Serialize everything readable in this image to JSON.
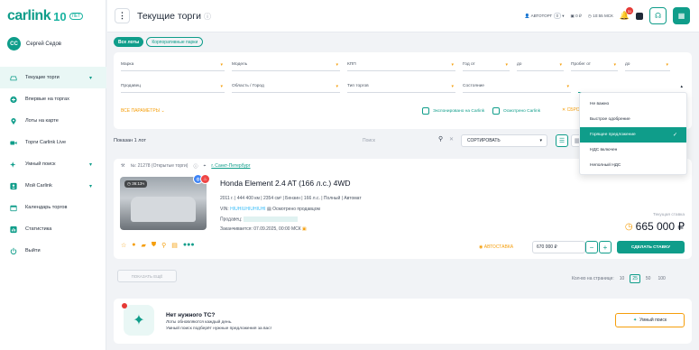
{
  "brand": {
    "name": "carlink",
    "anniversary": "10",
    "anniversary_suffix": "ЛЕТ"
  },
  "user": {
    "initials": "СС",
    "name": "Сергей Седов"
  },
  "sidebar": {
    "items": [
      {
        "label": "Текущие торги",
        "icon": "car-icon"
      },
      {
        "label": "Впервые на торгах",
        "icon": "plus-circle-icon"
      },
      {
        "label": "Лоты на карте",
        "icon": "map-pin-icon"
      },
      {
        "label": "Торги Carlink Live",
        "icon": "video-icon"
      },
      {
        "label": "Умный поиск",
        "icon": "sparkle-icon"
      },
      {
        "label": "Мой Carlink",
        "icon": "person-card-icon"
      },
      {
        "label": "Календарь торгов",
        "icon": "calendar-icon"
      },
      {
        "label": "Статистика",
        "icon": "chart-icon"
      },
      {
        "label": "Выйти",
        "icon": "power-icon"
      }
    ]
  },
  "header": {
    "title": "Текущие торги",
    "account": "АВТОТОРГ",
    "account_badge": "0",
    "balance": "0 ₽",
    "time": "10:55 МСК",
    "notifications": "31"
  },
  "tabs": {
    "all": "Все лоты",
    "corporate": "Корпоративные парки"
  },
  "filters": {
    "row1": [
      "Марка",
      "Модель",
      "КПП",
      "Год от",
      "до",
      "Пробег от",
      "до"
    ],
    "row2": [
      "Продавец",
      "Область / Город",
      "Тип торгов",
      "Состояние",
      ""
    ],
    "all_params": "ВСЕ ПАРАМЕТРЫ",
    "checked_carlink": "Экспонировано на Carlink",
    "inspected_carlink": "Осмотрено Carlink",
    "reset": "СБРОСИТЬ"
  },
  "dropdown": {
    "options": [
      "Не важно",
      "Быстрое одобрение",
      "Горящее предложение",
      "НДС включен",
      "Неполный НДС"
    ],
    "selected_index": 2
  },
  "results": {
    "count": "Показан 1 лот",
    "search_placeholder": "Поиск",
    "sort_label": "СОРТИРОВАТЬ"
  },
  "lot": {
    "number": "№: 21278 (Открытые торги)",
    "city": "г. Санкт-Петербург",
    "timer": "36:13ч",
    "title": "Honda Element 2.4 AT (166 л.с.) 4WD",
    "spec": "2011 г. | 444 400 км | 2354 см³ | Бензин | 166 л.с. | Полный | Автомат",
    "vin_label": "VIN:",
    "vin": "HIUHIUHIUHIUHI",
    "inspected": "Осмотрено продавцом",
    "seller_label": "Продавец:",
    "ends": "Заканчивается: 07.09.2025, 00:00 МСК",
    "current_label": "Текущая ставка",
    "price": "665 000 ₽",
    "autobid": "АВТОСТАВКА",
    "bid_value": "670 000 ₽",
    "make_bid": "СДЕЛАТЬ СТАВКУ"
  },
  "pagination": {
    "more": "ПОКАЗАТЬ ЕЩЁ",
    "per_page_label": "Кол-во на странице:",
    "options": [
      "10",
      "25",
      "50",
      "100"
    ],
    "selected": "25"
  },
  "promo": {
    "title": "Нет нужного ТС?",
    "line1": "Лоты обновляются каждый день.",
    "line2": "Умный поиск подберёт нужные предложения за вас!",
    "button": "Умный поиск"
  },
  "colors": {
    "accent": "#0f9d8a",
    "warning": "#f59e0b",
    "danger": "#e53935"
  }
}
